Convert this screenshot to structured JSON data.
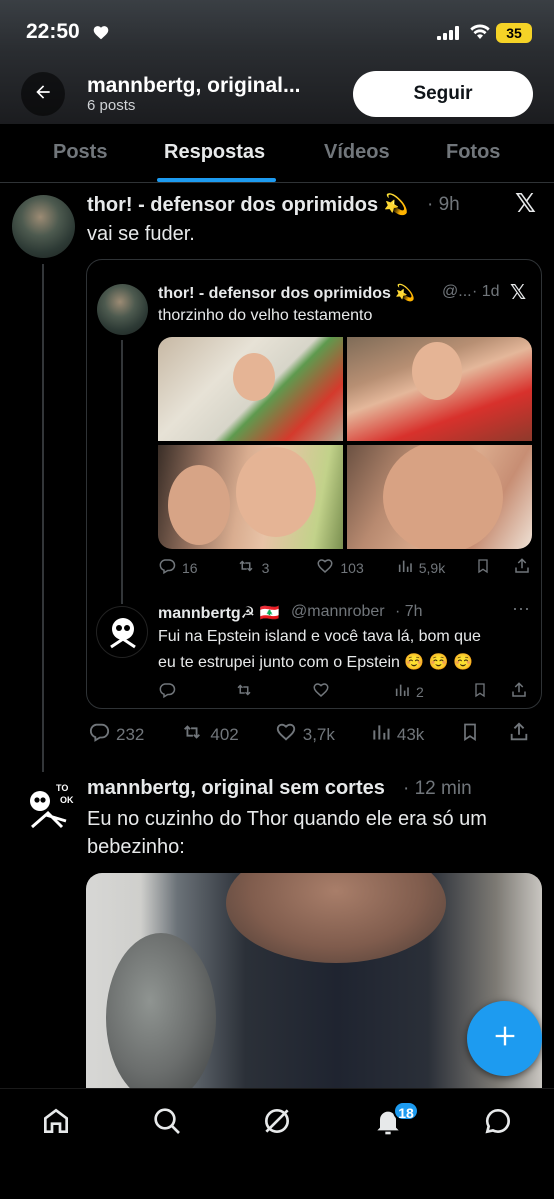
{
  "status_bar": {
    "time": "22:50",
    "battery": "35"
  },
  "header": {
    "title": "mannbertg, original...",
    "subtitle": "6 posts",
    "follow_label": "Seguir"
  },
  "tabs": [
    {
      "label": "Posts",
      "active": false
    },
    {
      "label": "Respostas",
      "active": true
    },
    {
      "label": "Vídeos",
      "active": false
    },
    {
      "label": "Fotos",
      "active": false
    }
  ],
  "tweet1": {
    "name": "thor! - defensor dos oprimidos 💫",
    "time": "· 9h",
    "text": "vai se fuder.",
    "quote": {
      "name": "thor! - defensor dos oprimidos 💫",
      "handle": "@...",
      "time": "· 1d",
      "text": "thorzinho do velho testamento",
      "stats": {
        "replies": "16",
        "reposts": "3",
        "likes": "103",
        "views": "5,9k"
      }
    },
    "reply": {
      "name": "mannbertg☭ 🇱🇧",
      "handle": "@mannrober",
      "time": "· 7h",
      "text_line1": "Fui na Epstein island e você tava lá, bom que",
      "text_line2": "eu te estrupei junto com o Epstein ☺️ ☺️ ☺️",
      "stats": {
        "replies": "",
        "reposts": "",
        "likes": "",
        "views": "2"
      }
    },
    "stats": {
      "replies": "232",
      "reposts": "402",
      "likes": "3,7k",
      "views": "43k"
    }
  },
  "tweet2": {
    "name": "mannbertg, original sem cortes",
    "time": "· 12 min",
    "text_line1": "Eu no cuzinho do Thor quando ele era só um",
    "text_line2": "bebezinho:"
  },
  "bottom_nav": {
    "notifications_badge": "18"
  },
  "colors": {
    "accent": "#1d9bf0",
    "muted": "#71767b",
    "text": "#e7e9ea",
    "border": "#2f3336"
  }
}
